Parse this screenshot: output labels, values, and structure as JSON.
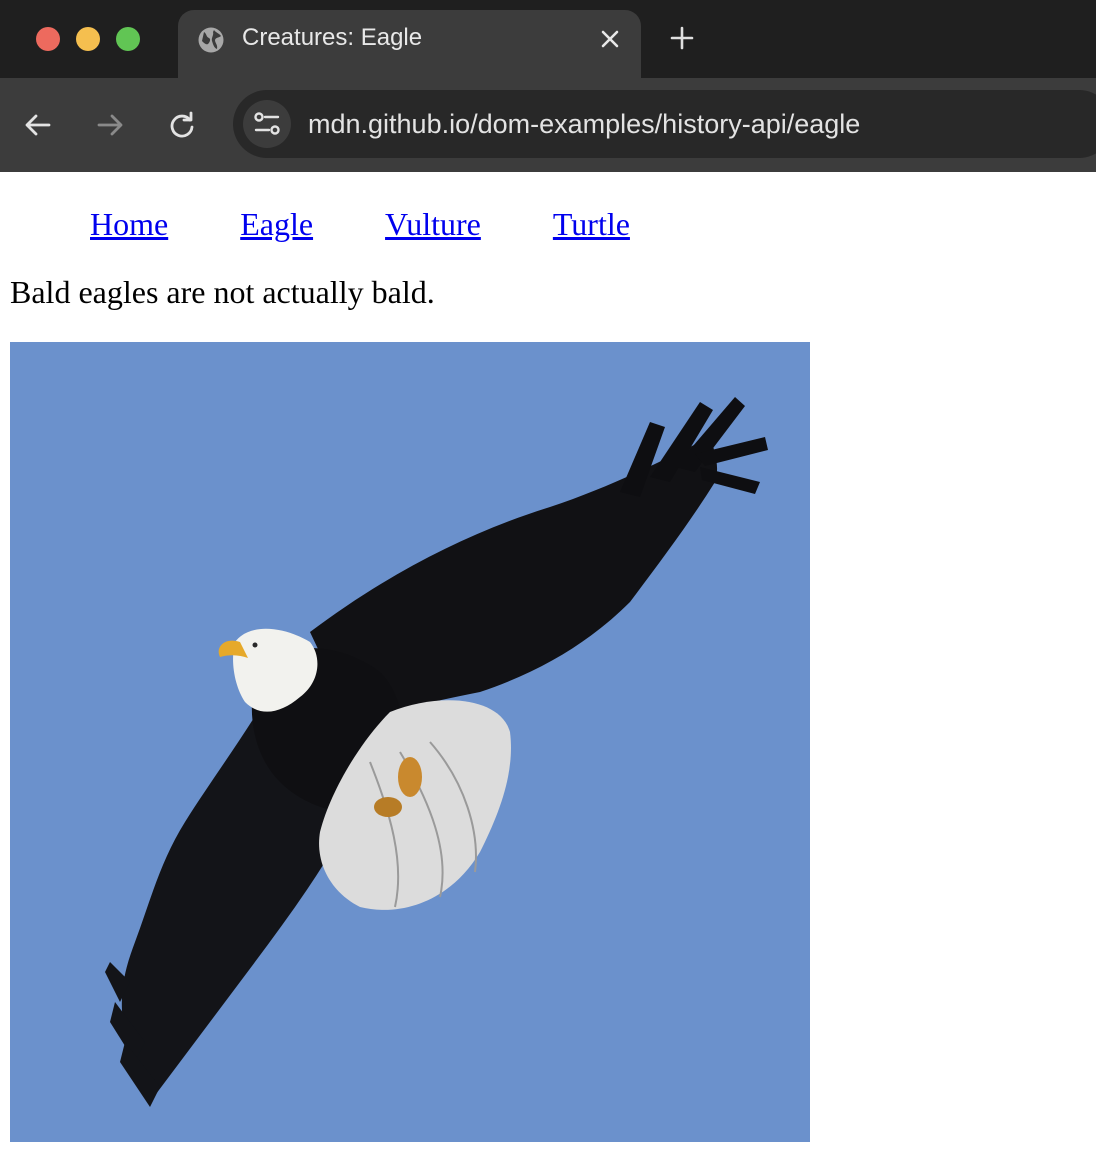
{
  "browser": {
    "tab": {
      "title": "Creatures: Eagle",
      "icon": "globe-icon"
    },
    "address_bar": {
      "url": "mdn.github.io/dom-examples/history-api/eagle"
    },
    "icons": [
      "back-arrow-icon",
      "forward-arrow-icon",
      "reload-icon",
      "site-info-icon",
      "close-icon",
      "plus-icon"
    ]
  },
  "page": {
    "nav": [
      {
        "label": "Home"
      },
      {
        "label": "Eagle"
      },
      {
        "label": "Vulture"
      },
      {
        "label": "Turtle"
      }
    ],
    "caption": "Bald eagles are not actually bald.",
    "image": {
      "subject": "bald eagle in flight",
      "sky_color": "#6b91cc"
    }
  },
  "colors": {
    "link": "#0000ee",
    "chrome_dark": "#1f1f1f",
    "chrome_tab": "#3c3c3c"
  }
}
